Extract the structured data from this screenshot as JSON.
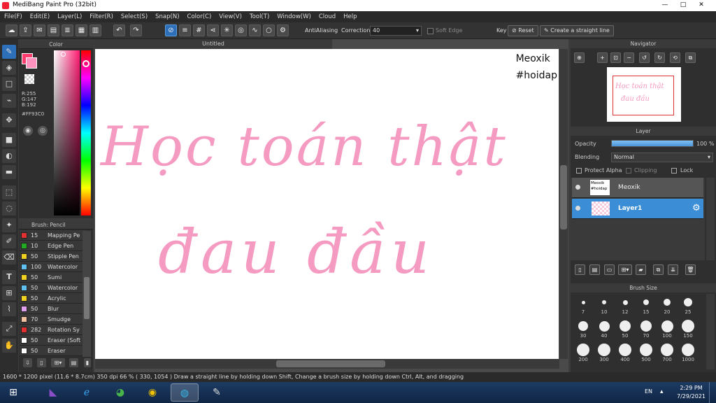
{
  "window": {
    "title": "MediBang Paint Pro (32bit)",
    "minimize": "—",
    "maximize": "□",
    "close": "✕"
  },
  "menu": [
    "File(F)",
    "Edit(E)",
    "Layer(L)",
    "Filter(R)",
    "Select(S)",
    "Snap(N)",
    "Color(C)",
    "View(V)",
    "Tool(T)",
    "Window(W)",
    "Cloud",
    "Help"
  ],
  "toolbar": {
    "antialiasing": "AntiAliasing",
    "correction_label": "Correction",
    "correction_value": "40",
    "soft_edge": "Soft Edge",
    "key_label": "Key",
    "reset": "Reset",
    "straight_line": "Create a straight line"
  },
  "color_panel": {
    "title": "Color",
    "r": "R:255",
    "g": "G:147",
    "b": "B:192",
    "hex": "#FF93C0",
    "accent": "#ff93c0"
  },
  "brush_panel": {
    "title": "Brush: Pencil",
    "items": [
      {
        "size": "15",
        "name": "Mapping Pe",
        "color": "#e03030"
      },
      {
        "size": "10",
        "name": "Edge Pen",
        "color": "#22aa22"
      },
      {
        "size": "50",
        "name": "Stipple Pen",
        "color": "#f0d020"
      },
      {
        "size": "100",
        "name": "Watercolor",
        "color": "#60c0f0"
      },
      {
        "size": "50",
        "name": "Sumi",
        "color": "#f0d020"
      },
      {
        "size": "50",
        "name": "Watercolor",
        "color": "#60c0f0"
      },
      {
        "size": "50",
        "name": "Acrylic",
        "color": "#f0d020"
      },
      {
        "size": "50",
        "name": "Blur",
        "color": "#e0a0f0"
      },
      {
        "size": "70",
        "name": "Smudge",
        "color": "#f0c0a0"
      },
      {
        "size": "282",
        "name": "Rotation Sy",
        "color": "#e03030"
      },
      {
        "size": "50",
        "name": "Eraser (Soft",
        "color": "#ffffff"
      },
      {
        "size": "50",
        "name": "Eraser",
        "color": "#ffffff"
      }
    ]
  },
  "canvas": {
    "tab": "Untitled",
    "watermark_line1": "Meoxik",
    "watermark_line2": "#hoidap",
    "line1": "Học toán thật",
    "line2": "đau đầu",
    "ink_color": "#f59bc2"
  },
  "navigator": {
    "title": "Navigator",
    "preview_line1": "Học toán thật",
    "preview_line2": "đau đầu"
  },
  "layer_panel": {
    "title": "Layer",
    "opacity_label": "Opacity",
    "opacity_value": "100 %",
    "opacity_fraction": 1.0,
    "blending_label": "Blending",
    "blending_value": "Normal",
    "protect_alpha": "Protect Alpha",
    "clipping": "Clipping",
    "lock": "Lock",
    "layers": [
      {
        "name": "Meoxik",
        "thumb1": "Meoxik",
        "thumb2": "#hoidap",
        "selected": false
      },
      {
        "name": "Layer1",
        "selected": true
      }
    ]
  },
  "brush_size_panel": {
    "title": "Brush Size",
    "sizes": [
      "7",
      "10",
      "12",
      "15",
      "20",
      "25",
      "30",
      "40",
      "50",
      "70",
      "100",
      "150",
      "200",
      "300",
      "400",
      "500",
      "700",
      "1000"
    ]
  },
  "status": {
    "text": "1600 * 1200 pixel  (11.6 * 8.7cm)  350 dpi  66 %  ( 330, 1054 )  Draw a straight line by holding down Shift, Change a brush size by holding down Ctrl, Alt, and dragging"
  },
  "taskbar": {
    "lang": "EN",
    "time": "2:29 PM",
    "date": "7/29/2021"
  }
}
